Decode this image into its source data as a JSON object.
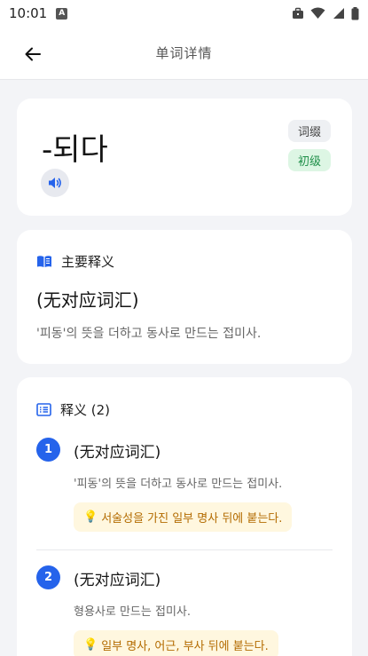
{
  "status_bar": {
    "time": "10:01",
    "notification_letter": "A"
  },
  "app_bar": {
    "title": "单词详情"
  },
  "word": {
    "text": "-되다",
    "type_badge": "词缀",
    "level_badge": "初级"
  },
  "main_definition": {
    "heading": "主要释义",
    "title": "(无对应词汇)",
    "description": "'피동'의 뜻을 더하고 동사로 만드는 접미사."
  },
  "definitions": {
    "heading": "释义 (2)",
    "items": [
      {
        "number": "1",
        "title": "(无对应词汇)",
        "description": "'피동'의 뜻을 더하고 동사로 만드는 접미사.",
        "note": "서술성을 가진 일부 명사 뒤에 붙는다."
      },
      {
        "number": "2",
        "title": "(无对应词汇)",
        "description": "형용사로 만드는 접미사.",
        "note": "일부 명사, 어근, 부사 뒤에 붙는다."
      }
    ]
  },
  "colors": {
    "accent": "#2563eb",
    "level_badge_bg": "#ddf6e4",
    "level_badge_text": "#1f8f49",
    "note_bg": "#fff7df",
    "note_text": "#b36b00"
  },
  "icons": {
    "back": "arrow-left-icon",
    "speak": "speaker-icon",
    "main_section": "book-icon",
    "definitions_section": "list-icon",
    "note": "lightbulb-icon"
  }
}
